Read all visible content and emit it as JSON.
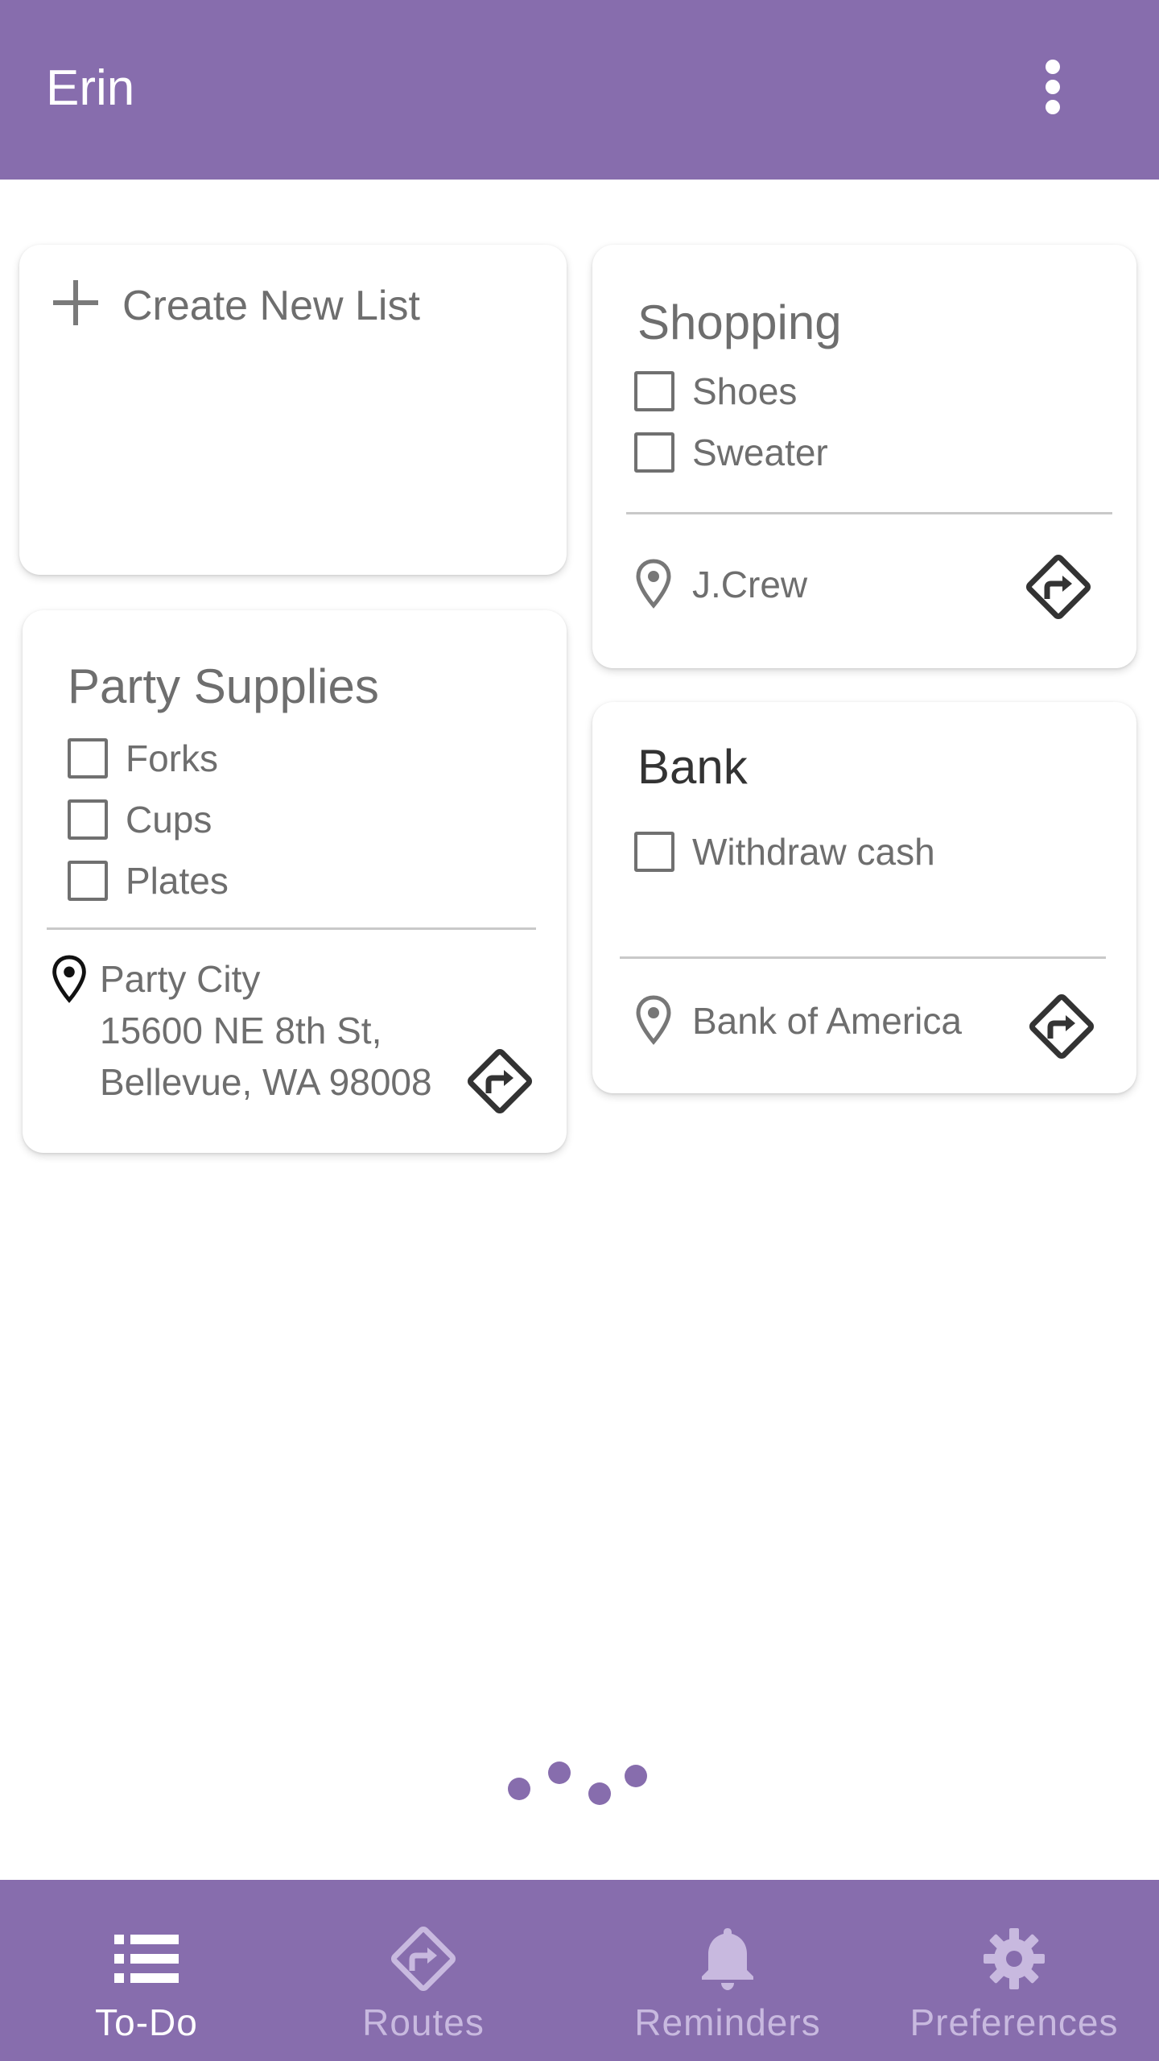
{
  "app_bar": {
    "title": "Erin",
    "menu_icon": "more-vert-icon"
  },
  "create_card": {
    "label": "Create New List",
    "icon": "plus-icon"
  },
  "cards": {
    "shopping": {
      "title": "Shopping",
      "items": [
        {
          "label": "Shoes",
          "checked": false
        },
        {
          "label": "Sweater",
          "checked": false
        }
      ],
      "location": "J.Crew"
    },
    "party": {
      "title": "Party Supplies",
      "items": [
        {
          "label": "Forks",
          "checked": false
        },
        {
          "label": "Cups",
          "checked": false
        },
        {
          "label": "Plates",
          "checked": false
        }
      ],
      "location_name": "Party City",
      "address_line1": "15600 NE 8th St,",
      "address_line2": "Bellevue, WA 98008"
    },
    "bank": {
      "title": "Bank",
      "items": [
        {
          "label": "Withdraw cash",
          "checked": false
        }
      ],
      "location": "Bank of America"
    }
  },
  "bottom_nav": {
    "items": [
      {
        "label": "To-Do",
        "icon": "list-icon",
        "active": true
      },
      {
        "label": "Routes",
        "icon": "directions-icon",
        "active": false
      },
      {
        "label": "Reminders",
        "icon": "bell-icon",
        "active": false
      },
      {
        "label": "Preferences",
        "icon": "gear-icon",
        "active": false
      }
    ]
  },
  "colors": {
    "primary": "#876dad",
    "accent_dots": "#876dad",
    "nav_inactive": "#c8b9df",
    "text_gray": "#6e6e6e"
  }
}
